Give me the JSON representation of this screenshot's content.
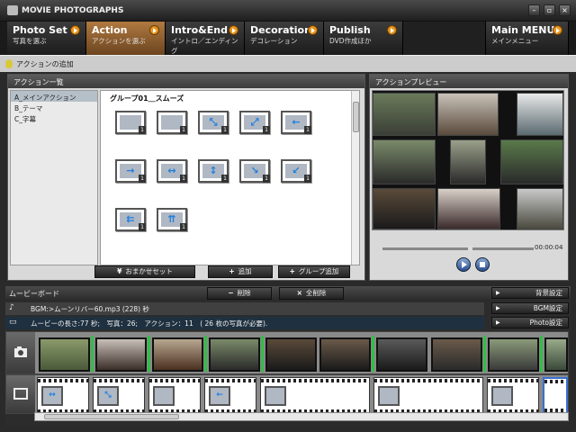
{
  "window": {
    "title": "MOVIE PHOTOGRAPHS"
  },
  "tabs": [
    {
      "title": "Photo Set",
      "sub": "写真を選ぶ"
    },
    {
      "title": "Action",
      "sub": "アクションを選ぶ"
    },
    {
      "title": "Intro&End",
      "sub": "イントロ／エンディング"
    },
    {
      "title": "Decoration",
      "sub": "デコレーション"
    },
    {
      "title": "Publish",
      "sub": "DVD作成ほか"
    },
    {
      "title": "Main MENU",
      "sub": "メインメニュー"
    }
  ],
  "subbar": {
    "label": "アクションの追加"
  },
  "action_list": {
    "title": "アクション一覧",
    "categories": [
      "A_メインアクション",
      "B_テーマ",
      "C_字幕"
    ],
    "group_title": "グループ01＿スムーズ",
    "thumb_badges": [
      "1",
      "1",
      "1",
      "1",
      "1",
      "1",
      "1",
      "1",
      "1",
      "1",
      "1",
      "1"
    ],
    "buttons": {
      "auto": "おまかせセット",
      "add": "追加",
      "group_add": "グループ追加"
    }
  },
  "preview": {
    "title": "アクションプレビュー",
    "time": "00:00:04",
    "seek_fraction": 0.58
  },
  "board": {
    "title": "ムービーボード",
    "delete": "削除",
    "delete_all": "全削除",
    "bgm_row": "BGM:>ムーンリバー60.mp3 (228) 秒",
    "info_row": "ムービーの長さ:77 秒;　写真：26;　アクション：11　( 26 枚の写真が必要).",
    "side_buttons": [
      "背景設定",
      "BGM設定",
      "Photo設定"
    ]
  }
}
